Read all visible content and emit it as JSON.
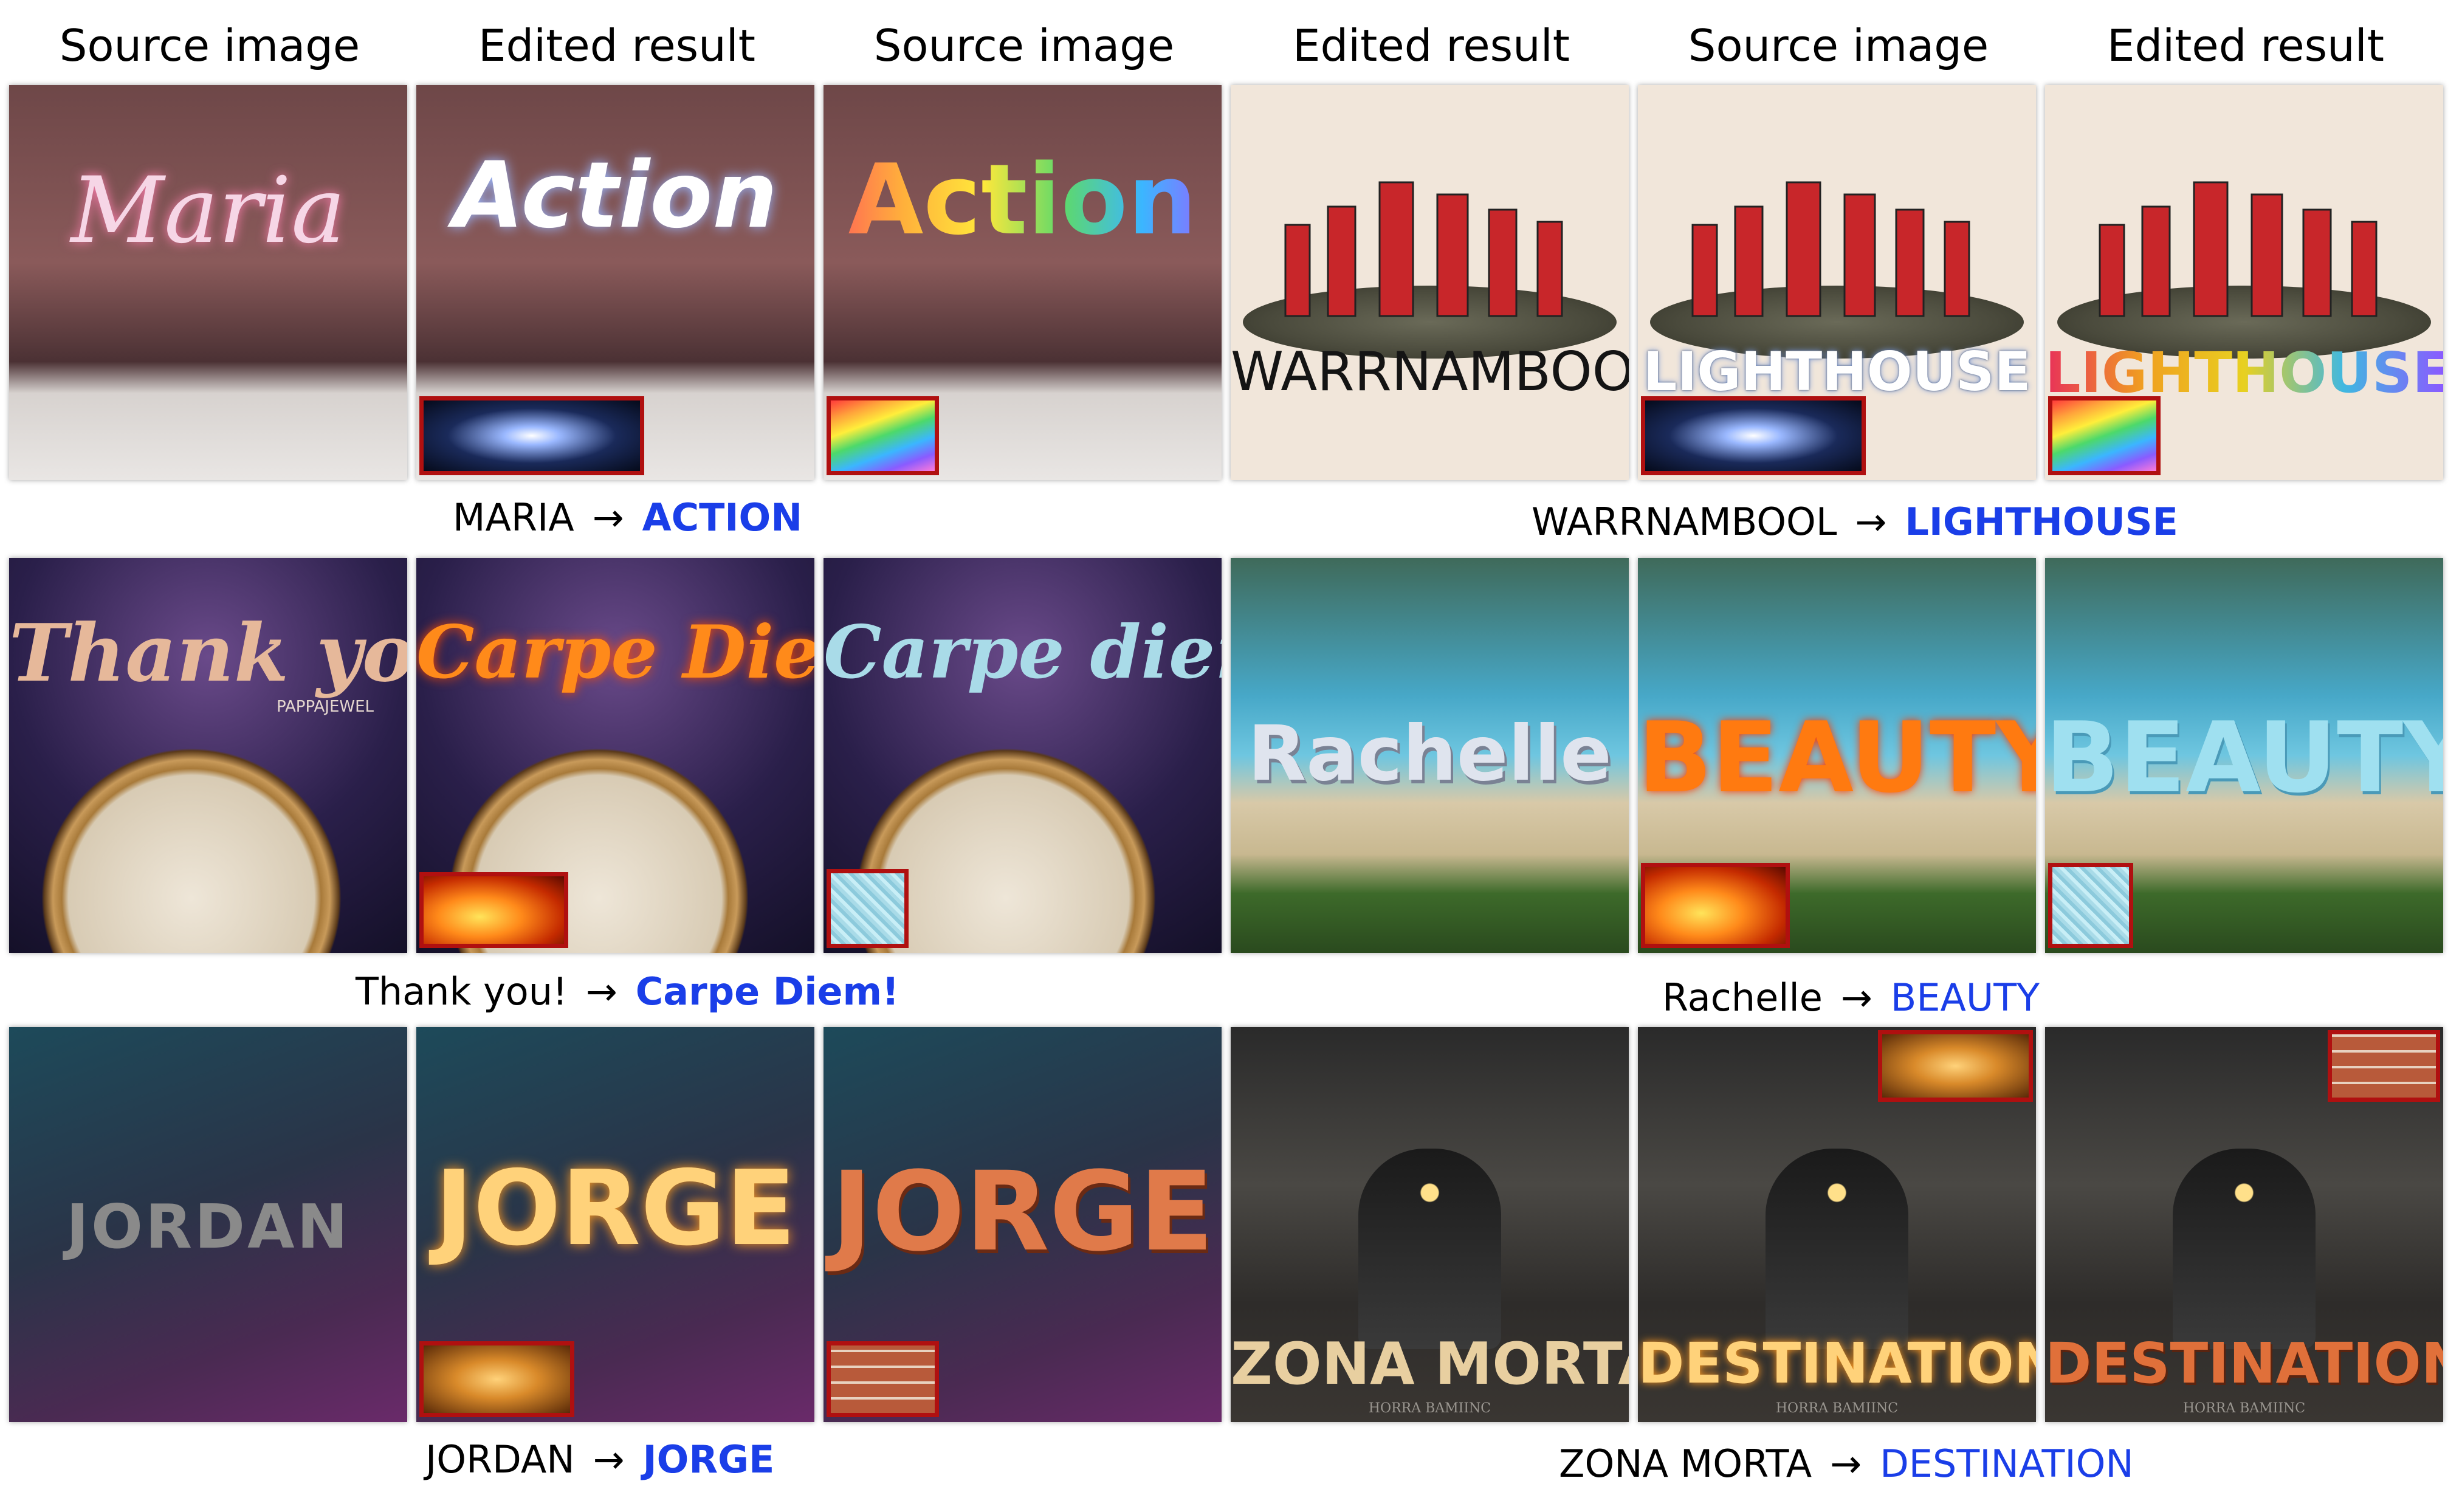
{
  "headers": [
    "Source image",
    "Edited result",
    "Source image",
    "Edited result",
    "Source image",
    "Edited result"
  ],
  "rows": [
    {
      "left": {
        "panels": [
          {
            "word": "Maria",
            "color": "#f6d6e6",
            "swatch": null
          },
          {
            "word": "Action",
            "color": "#ffffff",
            "swatch": "lightning"
          },
          {
            "word": "Action",
            "color": "#f0c040",
            "swatch": "rainbow"
          }
        ],
        "caption": {
          "src": "MARIA",
          "arrow": "→",
          "dst": "ACTION"
        }
      },
      "right": {
        "panels": [
          {
            "word": "WARRNAMBOOL",
            "color": "#141414",
            "swatch": null
          },
          {
            "word": "LIGHTHOUSE",
            "color": "#e8eef8",
            "swatch": "lightning"
          },
          {
            "word": "LIGHTHOUSE",
            "color": "#e6408a",
            "swatch": "rainbow"
          }
        ],
        "caption": {
          "src": "WARRNAMBOOL",
          "arrow": "→",
          "dst": "LIGHTHOUSE"
        }
      }
    },
    {
      "left": {
        "panels": [
          {
            "word": "Thank you!",
            "sub": "PAPPAJEWEL",
            "color": "#e6b89a",
            "swatch": null
          },
          {
            "word": "Carpe Diem!",
            "color": "#ff8a1a",
            "swatch": "fire"
          },
          {
            "word": "Carpe diem!",
            "color": "#a9dbe8",
            "swatch": "ice"
          }
        ],
        "caption": {
          "src": "Thank you!",
          "arrow": "→",
          "dst": "Carpe Diem!"
        }
      },
      "right": {
        "panels": [
          {
            "word": "Rachelle",
            "color": "#dfe4ee",
            "swatch": null
          },
          {
            "word": "BEAUTY",
            "color": "#ff7a10",
            "swatch": "fire"
          },
          {
            "word": "BEAUTY",
            "color": "#9fe0f0",
            "swatch": "ice"
          }
        ],
        "caption": {
          "src": "Rachelle",
          "arrow": "→",
          "dst": "BEAUTY"
        }
      }
    },
    {
      "left": {
        "panels": [
          {
            "word": "JORDAN",
            "color": "#8a8a8a",
            "swatch": null
          },
          {
            "word": "JORGE",
            "color": "#ffd27a",
            "swatch": "sparks"
          },
          {
            "word": "JORGE",
            "color": "#e07a4a",
            "swatch": "brick"
          }
        ],
        "caption": {
          "src": "JORDAN",
          "arrow": "→",
          "dst": "JORGE"
        }
      },
      "right": {
        "panels": [
          {
            "word": "ZONA MORTA",
            "sub": "HORRA BAMIINC",
            "color": "#e8cfa0",
            "swatch": null
          },
          {
            "word": "DESTINATION",
            "sub": "HORRA BAMIINC",
            "color": "#ffd27a",
            "swatch": "sparks"
          },
          {
            "word": "DESTINATION",
            "sub": "HORRA BAMIINC",
            "color": "#e0703a",
            "swatch": "brick"
          }
        ],
        "caption": {
          "src": "ZONA MORTA",
          "arrow": "→",
          "dst": "DESTINATION"
        }
      }
    }
  ]
}
